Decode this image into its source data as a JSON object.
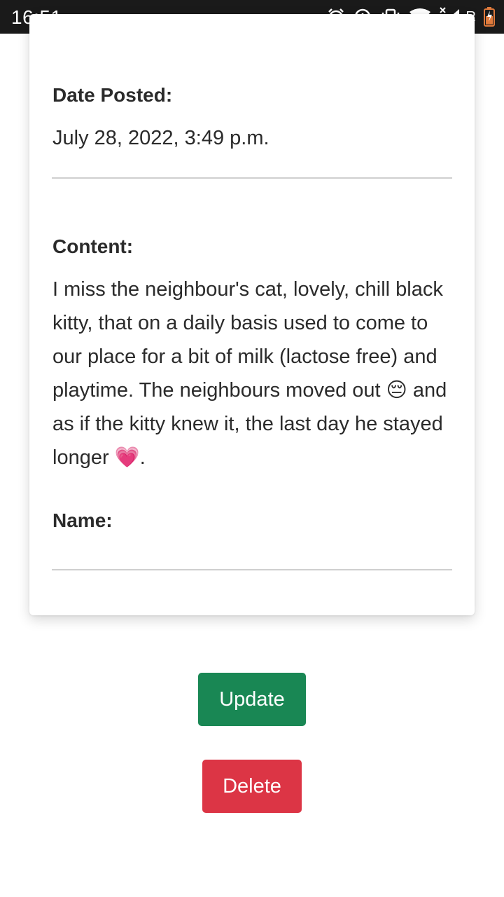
{
  "status_bar": {
    "time": "16:51",
    "network_label": "R",
    "icons": [
      "alarm-icon",
      "data-saver-icon",
      "vibrate-icon",
      "wifi-icon",
      "cell-signal-icon",
      "battery-icon"
    ]
  },
  "post": {
    "date_label": "Date Posted:",
    "date_value": "July 28, 2022, 3:49 p.m.",
    "content_label": "Content:",
    "content_value": "I miss the neighbour's cat, lovely, chill black kitty, that on a daily basis used to come to our place for a bit of milk (lactose free) and playtime. The neighbours moved out 😔 and as if the kitty knew it, the last day he stayed longer 💗.",
    "name_label": "Name:",
    "name_value": ""
  },
  "actions": {
    "update_label": "Update",
    "delete_label": "Delete"
  },
  "colors": {
    "update_button": "#198754",
    "delete_button": "#dc3545",
    "status_bar": "#1a1a1a"
  }
}
